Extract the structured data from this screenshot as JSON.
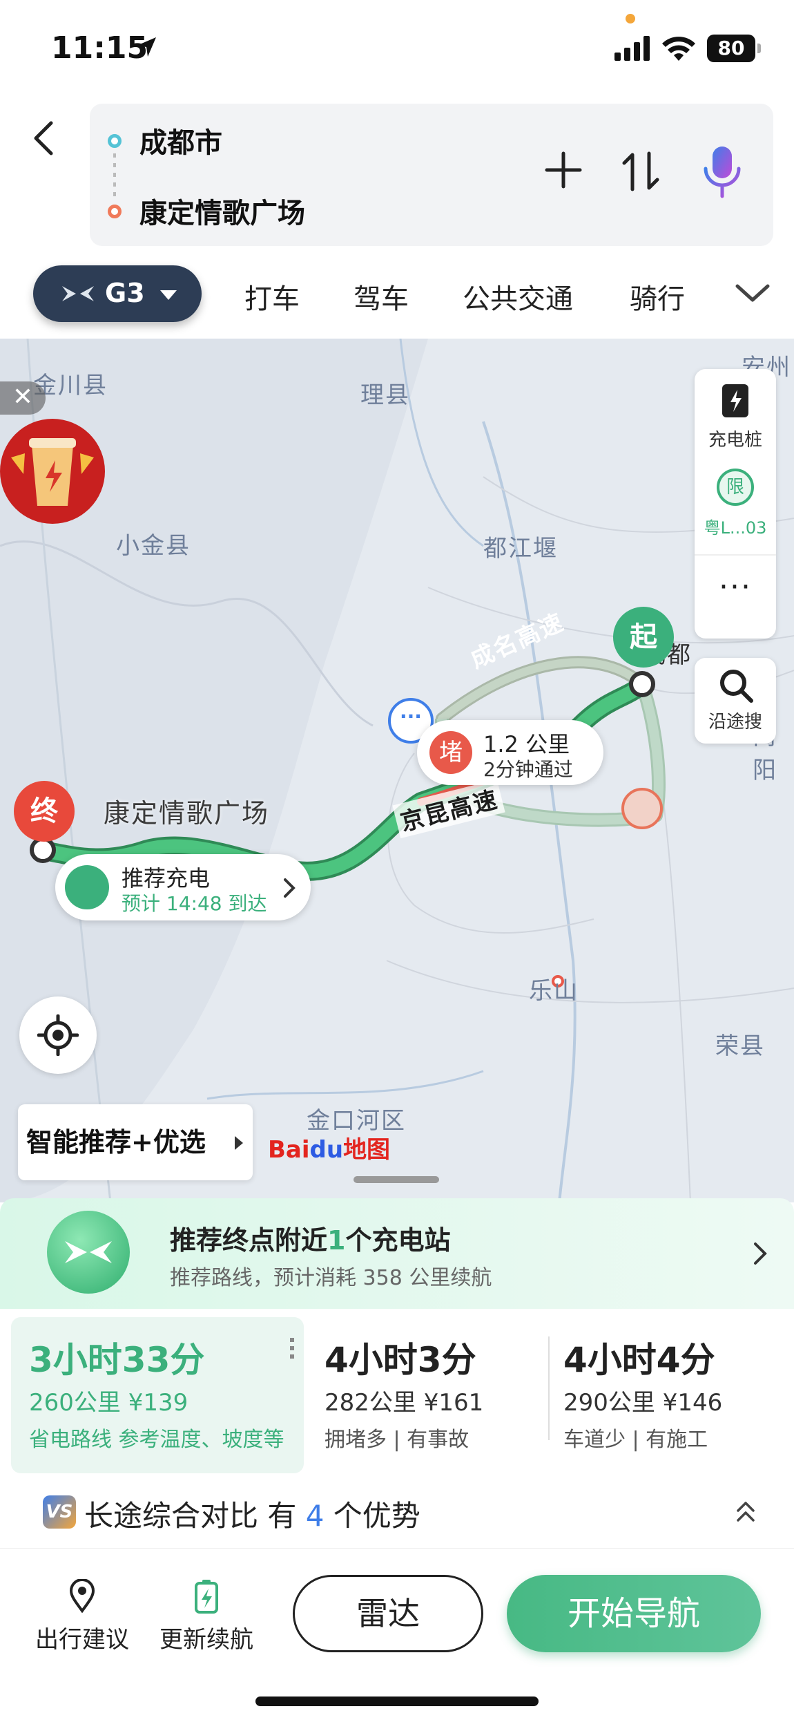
{
  "status_bar": {
    "time": "11:15",
    "battery": "80"
  },
  "search": {
    "origin": "成都市",
    "destination": "康定情歌广场"
  },
  "vehicle_chip": {
    "label": "G3"
  },
  "mode_tabs": [
    "打车",
    "驾车",
    "公共交通",
    "骑行"
  ],
  "map": {
    "labels": [
      "金川县",
      "理县",
      "小金县",
      "都江堰",
      "乐山",
      "荣县",
      "金口河区",
      "安州",
      "简阳",
      "成名高速",
      "京昆高速",
      "成都"
    ],
    "side_panel": {
      "charge_label": "充电桩",
      "limit_icon": "限",
      "plate_label": "粤L...03",
      "more": "···",
      "along_search": "沿途搜"
    },
    "start_pin": "起",
    "end_pin": "终",
    "destination_label": "康定情歌广场",
    "jam": {
      "icon": "堵",
      "distance": "1.2 公里",
      "time": "2分钟通过"
    },
    "charge_bubble": {
      "title": "推荐充电",
      "eta": "预计 14:48 到达"
    },
    "promo_close": "✕",
    "smart_button": "智能推荐+优选",
    "brand": {
      "bai": "Bai",
      "du": "du",
      "suffix": "地图"
    }
  },
  "banner": {
    "title_pre": "推荐终点附近",
    "title_count": "1",
    "title_post": "个充电站",
    "subtitle": "推荐路线，预计消耗 358 公里续航"
  },
  "routes": [
    {
      "duration": "3小时33分",
      "meta": "260公里 ¥139",
      "tags": "省电路线 参考温度、坡度等"
    },
    {
      "duration": "4小时3分",
      "meta": "282公里 ¥161",
      "tags": "拥堵多 | 有事故"
    },
    {
      "duration": "4小时4分",
      "meta": "290公里 ¥146",
      "tags": "车道少 | 有施工"
    }
  ],
  "compare": {
    "vs": "VS",
    "pre": "长途综合对比 有 ",
    "count": "4",
    "post": " 个优势"
  },
  "bottom_bar": {
    "travel_advice": "出行建议",
    "update_range": "更新续航",
    "radar": "雷达",
    "start_nav": "开始导航"
  },
  "colors": {
    "accent_green": "#3bb07c",
    "jam_red": "#e8594a",
    "chip_navy": "#2d3d55"
  }
}
